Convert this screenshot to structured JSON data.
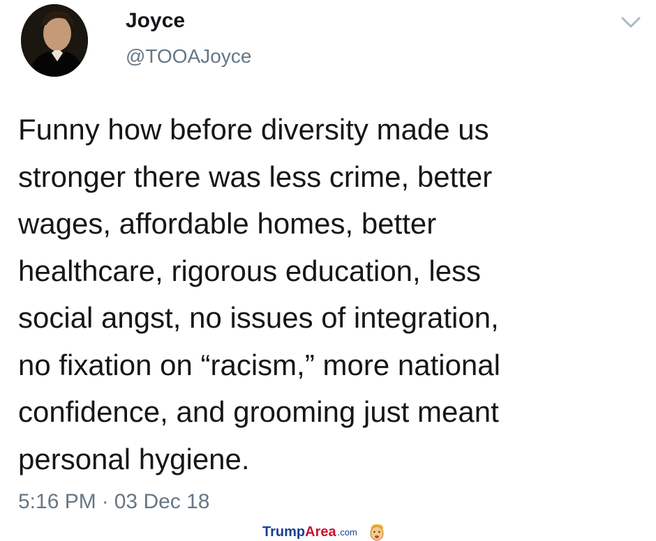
{
  "tweet": {
    "author": {
      "display_name": "Joyce",
      "handle": "@TOOAJoyce",
      "avatar": "portrait-avatar"
    },
    "menu_icon": "chevron-down-icon",
    "text_lines": [
      "Funny how before diversity made us",
      "stronger there was less crime, better",
      "wages, affordable homes, better",
      "healthcare, rigorous education, less",
      "social angst, no issues of integration,",
      "no fixation on “racism,” more national",
      "confidence, and grooming just meant",
      "personal hygiene."
    ],
    "time": "5:16 PM",
    "separator": "·",
    "date": "03 Dec 18"
  },
  "watermark": {
    "part1": "Trump",
    "part2": "Area",
    "suffix": ".com",
    "icon": "cartoon-face-icon"
  },
  "colors": {
    "text": "#14171a",
    "secondary": "#657786",
    "watermark_blue": "#1b3f94",
    "watermark_red": "#c8102e"
  }
}
